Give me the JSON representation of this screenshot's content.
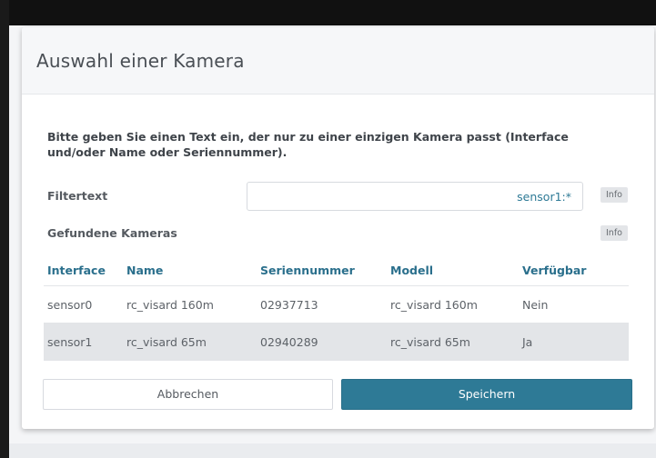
{
  "dialog": {
    "title": "Auswahl einer Kamera",
    "instruction": "Bitte geben Sie einen Text ein, der nur zu einer einzigen Kamera passt (Interface und/oder Name oder Seriennummer).",
    "filter_label": "Filtertext",
    "filter_value": "sensor1:*",
    "info_label": "Info",
    "found_label": "Gefundene Kameras",
    "table": {
      "headers": [
        "Interface",
        "Name",
        "Seriennummer",
        "Modell",
        "Verfügbar"
      ],
      "rows": [
        [
          "sensor0",
          "rc_visard 160m",
          "02937713",
          "rc_visard 160m",
          "Nein"
        ],
        [
          "sensor1",
          "rc_visard 65m",
          "02940289",
          "rc_visard 65m",
          "Ja"
        ]
      ],
      "selected_row": 1
    },
    "cancel_label": "Abbrechen",
    "save_label": "Speichern"
  },
  "colors": {
    "accent": "#2e7a96",
    "header_text": "#2a6f8c",
    "selected_row": "#e3e5e8"
  }
}
